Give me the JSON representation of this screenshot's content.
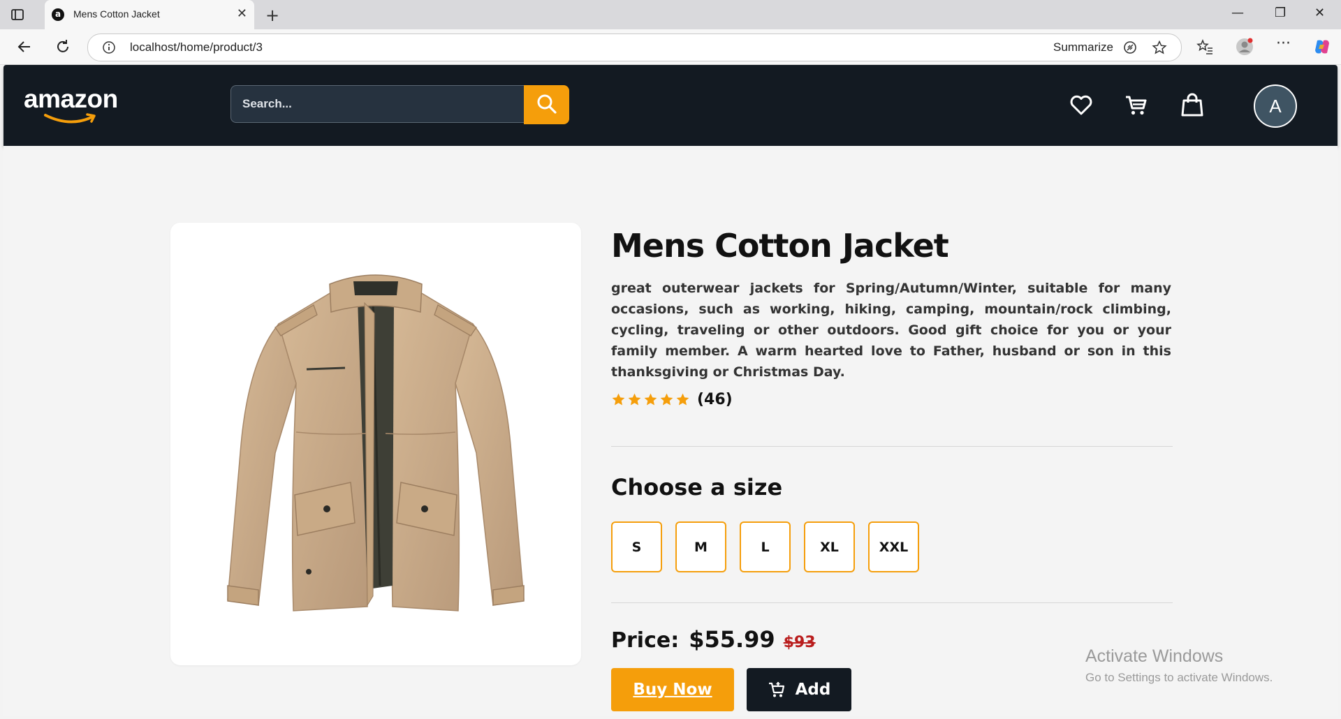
{
  "browser": {
    "tab_title": "Mens Cotton Jacket",
    "tab_favicon": "a",
    "url": "localhost/home/product/3",
    "summarize_label": "Summarize"
  },
  "header": {
    "logo_text": "amazon",
    "search_placeholder": "Search...",
    "avatar_letter": "A"
  },
  "product": {
    "title": "Mens Cotton Jacket",
    "description": "great outerwear jackets for Spring/Autumn/Winter, suitable for many occasions, such as working, hiking, camping, mountain/rock climbing, cycling, traveling or other outdoors. Good gift choice for you or your family member. A warm hearted love to Father, husband or son in this thanksgiving or Christmas Day.",
    "rating_stars": 5,
    "rating_count": "(46)",
    "size_heading": "Choose a size",
    "sizes": [
      "S",
      "M",
      "L",
      "XL",
      "XXL"
    ],
    "price_label": "Price:",
    "price": "$55.99",
    "old_price": "$93",
    "buy_label": "Buy Now",
    "add_label": "Add"
  },
  "watermark": {
    "line1": "Activate Windows",
    "line2": "Go to Settings to activate Windows."
  },
  "colors": {
    "header_bg": "#131a22",
    "accent": "#f59e0b",
    "old_price": "#b91c1c"
  }
}
